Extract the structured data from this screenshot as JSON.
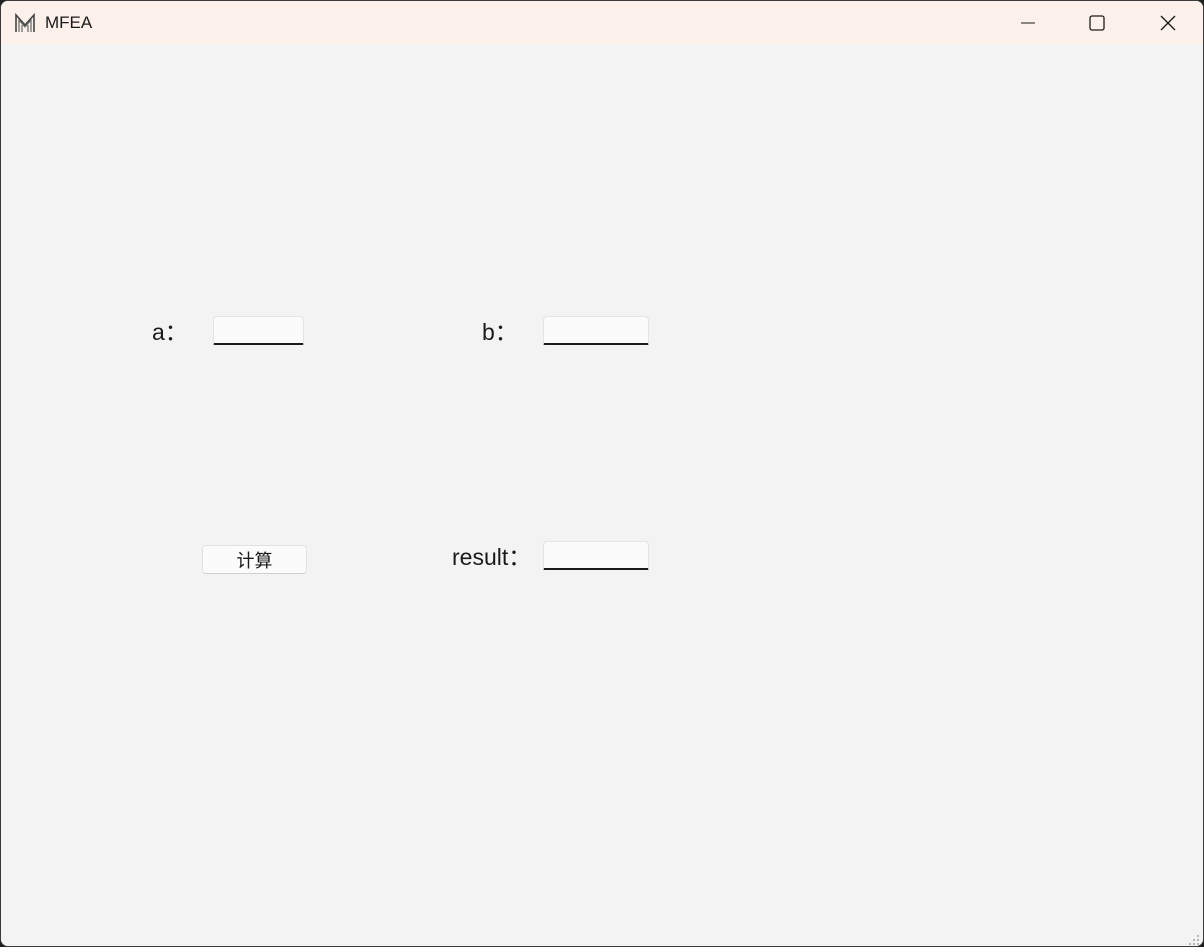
{
  "window": {
    "title": "MFEA",
    "controls": {
      "minimize": "minimize",
      "maximize": "maximize",
      "close": "close"
    }
  },
  "form": {
    "a_label": "a：",
    "a_value": "",
    "b_label": "b：",
    "b_value": "",
    "calc_button": "计算",
    "result_label": "result：",
    "result_value": ""
  },
  "colors": {
    "titlebar": "#fbf1ea",
    "client": "#f3f3f3",
    "text": "#1a1a1a"
  },
  "icons": {
    "app": "m-logo-icon",
    "minimize": "minimize-icon",
    "maximize": "maximize-icon",
    "close": "close-icon",
    "resize": "resize-grip-icon"
  }
}
